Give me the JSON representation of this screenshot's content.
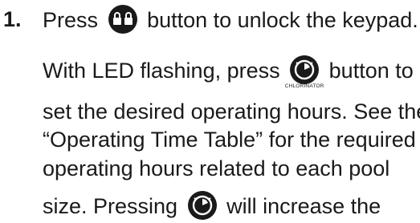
{
  "step": {
    "number": "1.",
    "line1": {
      "before": "Press",
      "after": "button to unlock the keypad."
    },
    "line2": {
      "before": "With LED flashing, press",
      "after": "button to"
    },
    "chlorinator_caption": "CHLORINATOR",
    "line3": "set the desired operating hours. See the",
    "line4": "“Operating Time Table” for the required",
    "line5": "operating hours related to each pool",
    "line6": {
      "before": "size. Pressing",
      "after": "will increase the"
    }
  },
  "icons": {
    "lock": "lock-button-icon",
    "timer": "chlorinator-timer-button-icon"
  },
  "colors": {
    "text": "#1a1a1a",
    "icon_fill": "#1a1a1a",
    "icon_glyph": "#ffffff"
  }
}
